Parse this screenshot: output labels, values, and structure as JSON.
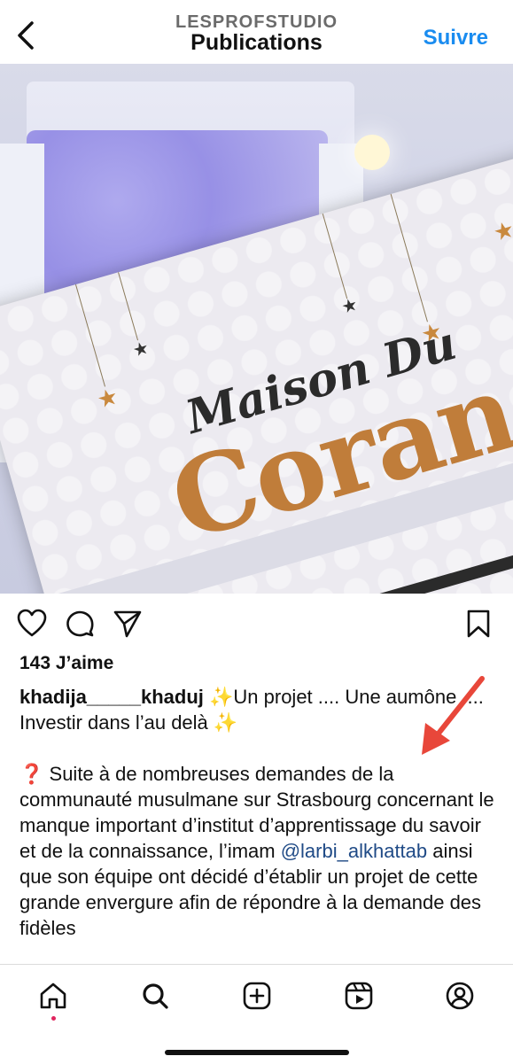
{
  "header": {
    "username": "LESPROFSTUDIO",
    "title": "Publications",
    "follow_label": "Suivre"
  },
  "post": {
    "image_text": {
      "brand": "Maison Du",
      "name": "Coran"
    },
    "likes": "143 J’aime",
    "caption_user": "khadija_____khaduj",
    "caption_line1": " ✨Un projet .... Une aumône .... Investir dans l’au delà ✨",
    "caption_p2_a": "❓",
    "caption_p2_b": " Suite à de nombreuses demandes de la communauté musulmane sur Strasbourg concernant le manque important d’institut d’apprentissage du savoir et de la connaissance, l’imam ",
    "caption_mention": "@larbi_alkhattab",
    "caption_p2_c": " ainsi que son équipe ont décidé d’établir un projet de cette grande envergure afin de répondre à la demande des fidèles"
  },
  "icons": {
    "back": "chevron-left-icon",
    "like": "heart-icon",
    "comment": "comment-icon",
    "share": "send-icon",
    "save": "bookmark-icon",
    "home": "home-icon",
    "search": "search-icon",
    "create": "plus-square-icon",
    "reels": "reels-icon",
    "profile": "profile-icon"
  },
  "colors": {
    "accent": "#1a8cf0",
    "mention": "#1f4a86",
    "arrow": "#e8473a"
  }
}
